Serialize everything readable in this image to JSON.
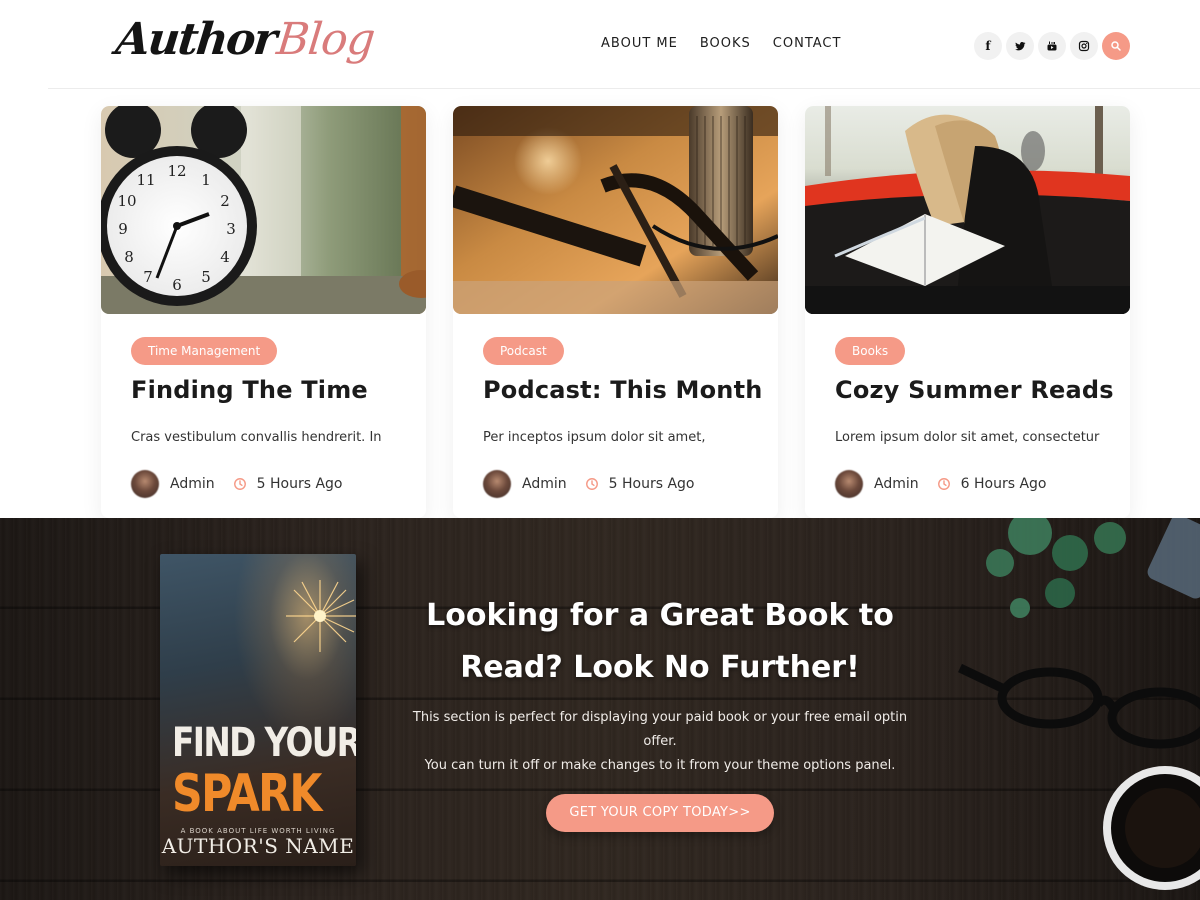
{
  "header": {
    "logo": {
      "part1": "Author",
      "part2": "Blog"
    },
    "nav": [
      {
        "label": "ABOUT ME"
      },
      {
        "label": "BOOKS"
      },
      {
        "label": "CONTACT"
      }
    ],
    "social": [
      {
        "icon": "facebook-icon",
        "glyph": "f"
      },
      {
        "icon": "twitter-icon",
        "glyph": "t"
      },
      {
        "icon": "youtube-icon",
        "glyph": "▶"
      },
      {
        "icon": "instagram-icon",
        "glyph": "◎"
      }
    ],
    "search_icon": "search-icon"
  },
  "posts": [
    {
      "category": "Time Management",
      "title": "Finding The Time",
      "excerpt": "Cras vestibulum convallis hendrerit. In",
      "author": "Admin",
      "time": "5 Hours Ago",
      "image": "alarm-clock-photo"
    },
    {
      "category": "Podcast",
      "title": "Podcast: This Month",
      "excerpt": "Per inceptos ipsum dolor sit amet,",
      "author": "Admin",
      "time": "5 Hours Ago",
      "image": "microphone-photo"
    },
    {
      "category": "Books",
      "title": "Cozy Summer Reads",
      "excerpt": "Lorem ipsum dolor sit amet, consectetur",
      "author": "Admin",
      "time": "6 Hours Ago",
      "image": "woman-reading-hammock-photo"
    }
  ],
  "banner": {
    "book": {
      "title_line1": "FIND YOUR",
      "title_line2": "SPARK",
      "tagline": "A BOOK ABOUT LIFE WORTH LIVING",
      "author": "AUTHOR'S NAME"
    },
    "heading": "Looking for a Great Book to Read? Look No Further!",
    "text_line1": "This section is perfect for displaying your paid book or your free email optin offer.",
    "text_line2": "You can turn it off or make changes to it from your theme options panel.",
    "cta": "GET YOUR COPY TODAY>>"
  },
  "colors": {
    "accent": "#f59a87",
    "logo_accent": "#d97b7b",
    "banner_wood": "#2a221d"
  }
}
